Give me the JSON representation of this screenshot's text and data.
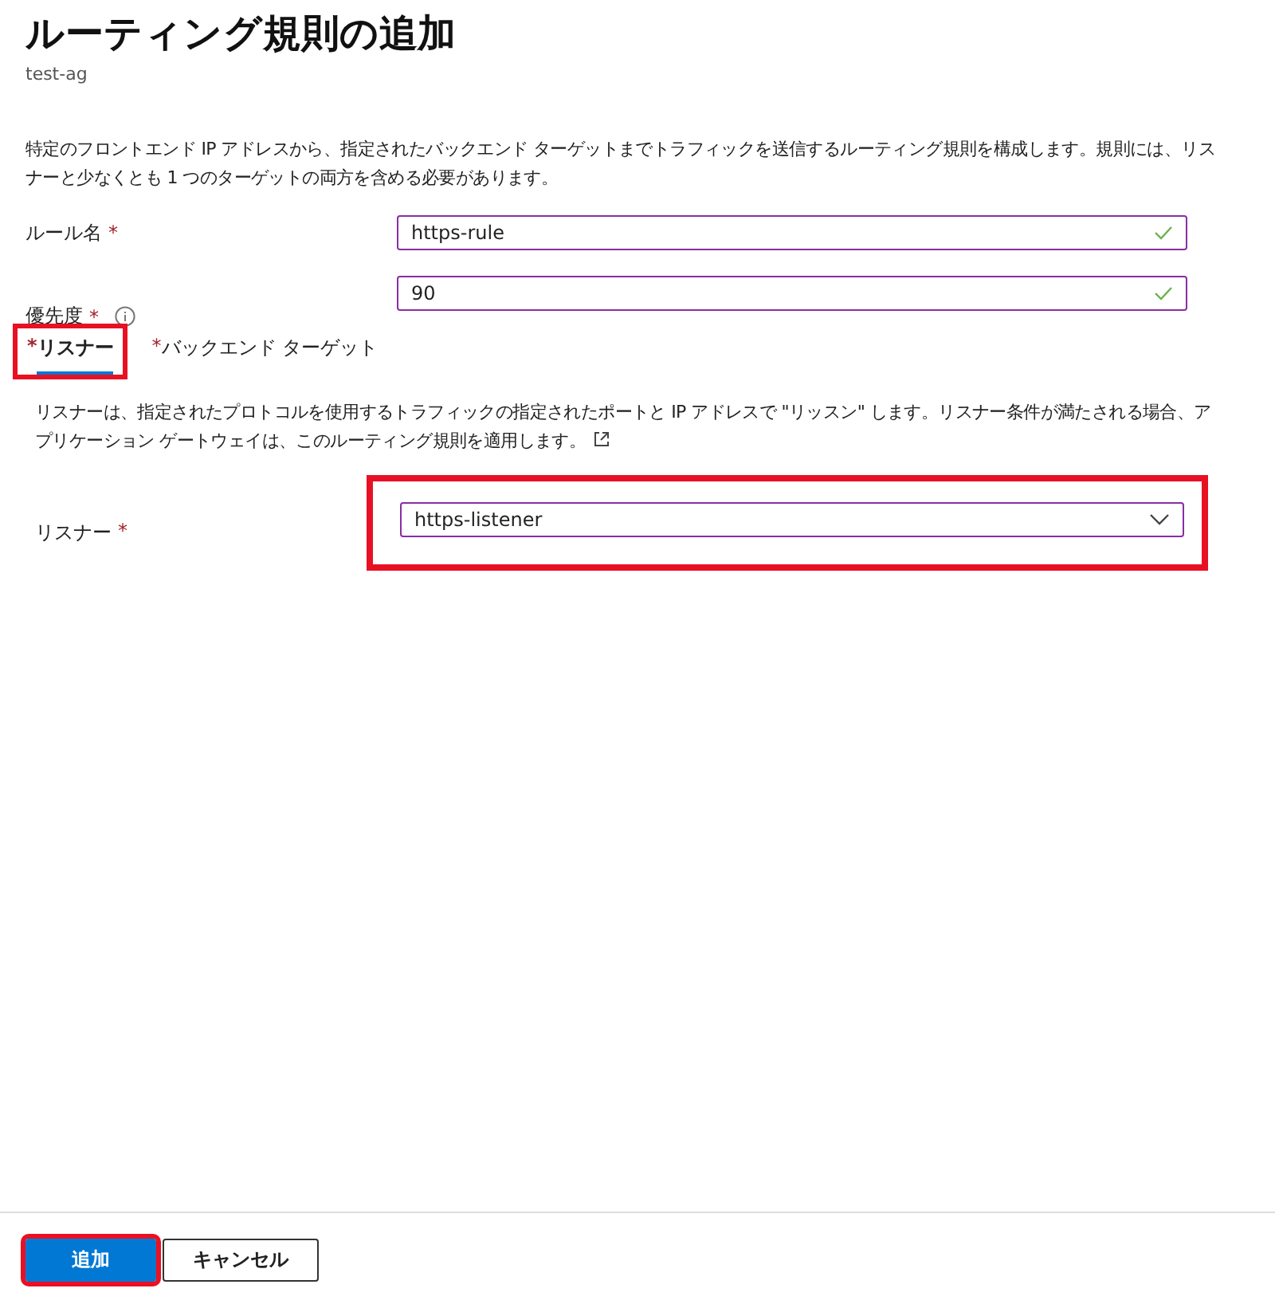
{
  "title": "ルーティング規則の追加",
  "subtitle": "test-ag",
  "description": "特定のフロントエンド IP アドレスから、指定されたバックエンド ターゲットまでトラフィックを送信するルーティング規則を構成します。規則には、リスナーと少なくとも 1 つのターゲットの両方を含める必要があります。",
  "fields": [
    {
      "label": "ルール名",
      "required_mark": "*",
      "info": false,
      "value": "https-rule",
      "valid": true
    },
    {
      "label": "優先度",
      "required_mark": "*",
      "info": true,
      "value": "90",
      "valid": true
    }
  ],
  "tabs": [
    {
      "label": "リスナー",
      "required_mark": "*",
      "selected": true,
      "highlighted": true
    },
    {
      "label": "バックエンド ターゲット",
      "required_mark": "*",
      "selected": false,
      "highlighted": false
    }
  ],
  "listener_panel": {
    "description": "リスナーは、指定されたプロトコルを使用するトラフィックの指定されたポートと IP アドレスで \"リッスン\" します。リスナー条件が満たされる場合、アプリケーション ゲートウェイは、このルーティング規則を適用します。",
    "external_link": true,
    "field": {
      "label": "リスナー",
      "required_mark": "*",
      "value": "https-listener",
      "highlighted": true
    }
  },
  "buttons": [
    {
      "label": "追加",
      "kind": "primary",
      "highlighted": true
    },
    {
      "label": "キャンセル",
      "kind": "secondary",
      "highlighted": false
    }
  ]
}
